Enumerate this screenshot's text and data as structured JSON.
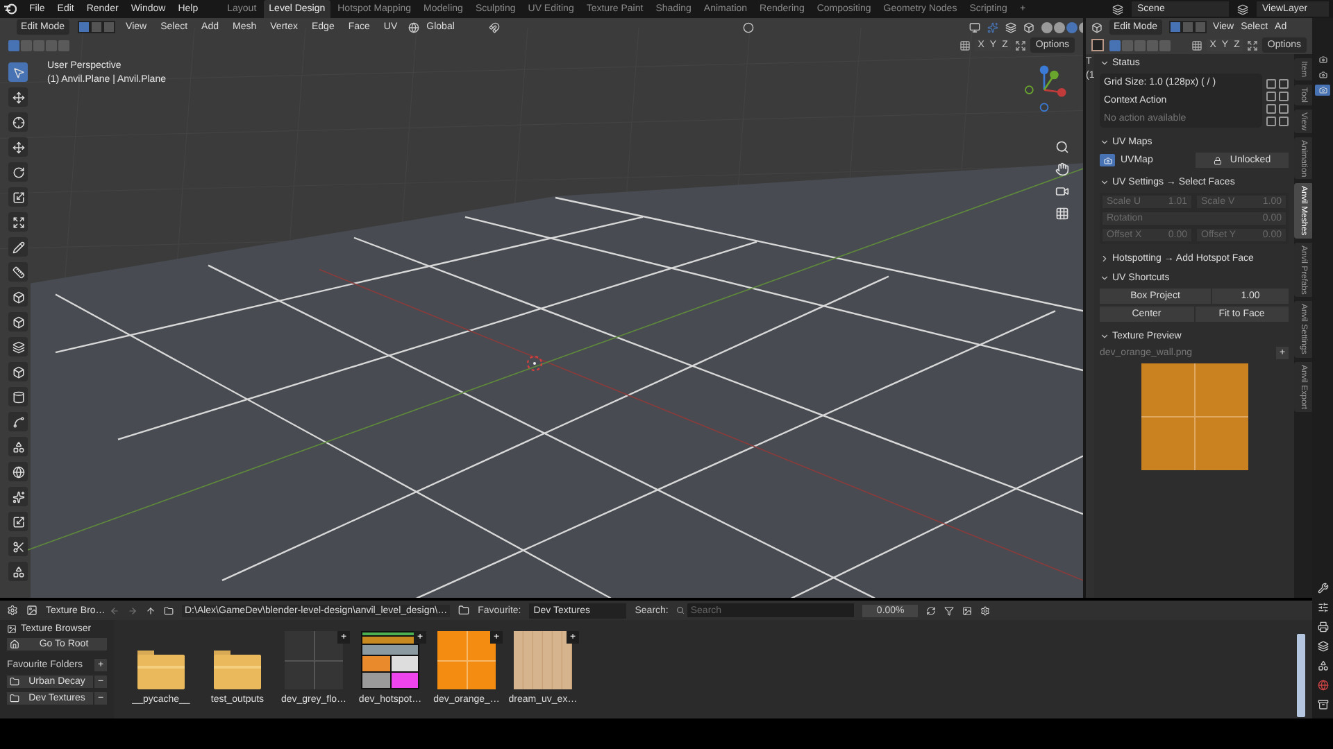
{
  "menu": [
    "File",
    "Edit",
    "Render",
    "Window",
    "Help"
  ],
  "workspaces": [
    {
      "label": "Layout",
      "selected": false
    },
    {
      "label": "Level Design",
      "selected": true
    },
    {
      "label": "Hotspot Mapping",
      "selected": false
    },
    {
      "label": "Modeling",
      "selected": false
    },
    {
      "label": "Sculpting",
      "selected": false
    },
    {
      "label": "UV Editing",
      "selected": false
    },
    {
      "label": "Texture Paint",
      "selected": false
    },
    {
      "label": "Shading",
      "selected": false
    },
    {
      "label": "Animation",
      "selected": false
    },
    {
      "label": "Rendering",
      "selected": false
    },
    {
      "label": "Compositing",
      "selected": false
    },
    {
      "label": "Geometry Nodes",
      "selected": false
    },
    {
      "label": "Scripting",
      "selected": false
    }
  ],
  "workspace_add": "+",
  "scene": "Scene",
  "view_layer": "ViewLayer",
  "viewport": {
    "mode": "Edit Mode",
    "select_modes": [
      {
        "selected": true
      },
      {
        "selected": false
      },
      {
        "selected": false
      }
    ],
    "menus": [
      "View",
      "Select",
      "Add",
      "Mesh",
      "Vertex",
      "Edge",
      "Face",
      "UV"
    ],
    "orientation": "Global",
    "shading_modes": [
      {
        "selected": false
      },
      {
        "selected": false
      },
      {
        "selected": true
      },
      {
        "selected": false
      }
    ],
    "box_modes": [
      {
        "selected": true
      },
      {
        "selected": false
      },
      {
        "selected": false
      },
      {
        "selected": false
      },
      {
        "selected": false
      }
    ],
    "axes": [
      "X",
      "Y",
      "Z"
    ],
    "options": "Options",
    "overlay_text": [
      "User Perspective",
      "(1) Anvil.Plane | Anvil.Plane"
    ],
    "tools": [
      {
        "selected": true
      },
      {
        "selected": false
      },
      {
        "selected": false
      },
      {
        "selected": false
      },
      {
        "selected": false
      },
      {
        "selected": false
      },
      {
        "selected": false
      },
      {
        "selected": false
      },
      {
        "selected": false
      },
      {
        "selected": false
      },
      {
        "selected": false
      },
      {
        "selected": false
      },
      {
        "selected": false
      },
      {
        "selected": false
      },
      {
        "selected": false
      },
      {
        "selected": false
      },
      {
        "selected": false
      },
      {
        "selected": false
      },
      {
        "selected": false
      },
      {
        "selected": false
      },
      {
        "selected": false
      }
    ]
  },
  "side_editor": {
    "mode": "Edit Mode",
    "select_modes": [
      {
        "selected": true
      },
      {
        "selected": false
      },
      {
        "selected": false
      }
    ],
    "menus": [
      "View",
      "Select",
      "Ad"
    ],
    "box_modes": [
      {
        "selected": true
      },
      {
        "selected": false
      },
      {
        "selected": false
      },
      {
        "selected": false
      },
      {
        "selected": false
      }
    ],
    "axes": [
      "X",
      "Y",
      "Z"
    ],
    "options": "Options",
    "cut_text": [
      "T",
      "(1"
    ],
    "tabs": [
      {
        "label": "Item",
        "selected": false
      },
      {
        "label": "Tool",
        "selected": false
      },
      {
        "label": "View",
        "selected": false
      },
      {
        "label": "Animation",
        "selected": false
      },
      {
        "label": "Anvil Meshes",
        "selected": true
      },
      {
        "label": "Anvil Prefabs",
        "selected": false
      },
      {
        "label": "Anvil Settings",
        "selected": false
      },
      {
        "label": "Anvil Export",
        "selected": false
      }
    ],
    "status": {
      "title": "Status",
      "expanded": true,
      "grid_size": "Grid Size: 1.0  (128px)  ( / )",
      "context_title": "Context Action",
      "context_text": "No action available"
    },
    "uv_maps": {
      "title": "UV Maps",
      "expanded": true,
      "map": "UVMap",
      "lock": "Unlocked"
    },
    "uv_settings": {
      "title": "UV Settings  → Select Faces",
      "expanded": true,
      "disabled": true,
      "fields": [
        {
          "label": "Scale U",
          "value": "1.01"
        },
        {
          "label": "Scale V",
          "value": "1.00"
        },
        {
          "label": "Rotation",
          "value": "0.00"
        },
        {
          "label": "Offset X",
          "value": "0.00"
        },
        {
          "label": "Offset Y",
          "value": "0.00"
        }
      ]
    },
    "hotspotting": {
      "title": "Hotspotting  → Add Hotspot Face",
      "expanded": false
    },
    "uv_shortcuts": {
      "title": "UV Shortcuts",
      "expanded": true,
      "box_project": "Box Project",
      "box_value": "1.00",
      "center": "Center",
      "fit": "Fit to Face"
    },
    "texture_preview": {
      "title": "Texture Preview",
      "expanded": true,
      "file": "dev_orange_wall.png",
      "add": "+"
    }
  },
  "properties_tabs": [
    {
      "selected": false
    },
    {
      "selected": false
    },
    {
      "selected": true
    }
  ],
  "file_browser": {
    "title": "Texture Bro…",
    "path": "D:\\Alex\\GameDev\\blender-level-design\\anvil_level_design\\…",
    "favourite_label": "Favourite:",
    "favourite": "Dev Textures",
    "search_label": "Search:",
    "search_placeholder": "Search",
    "zoom": "0.00%",
    "sidebar_title": "Texture Browser",
    "root": "Go To Root",
    "favourites_title": "Favourite Folders",
    "add": "+",
    "folders": [
      {
        "name": "Urban Decay",
        "remove": "−"
      },
      {
        "name": "Dev Textures",
        "remove": "−"
      }
    ],
    "items": [
      {
        "kind": "folder",
        "name": "__pycache__"
      },
      {
        "kind": "folder",
        "name": "test_outputs"
      },
      {
        "kind": "grey",
        "name": "dev_grey_flo…",
        "add": "+"
      },
      {
        "kind": "hotspot",
        "name": "dev_hotspot…",
        "add": "+"
      },
      {
        "kind": "orange",
        "name": "dev_orange_…",
        "add": "+"
      },
      {
        "kind": "wood",
        "name": "dream_uv_ex…",
        "add": "+"
      }
    ]
  }
}
